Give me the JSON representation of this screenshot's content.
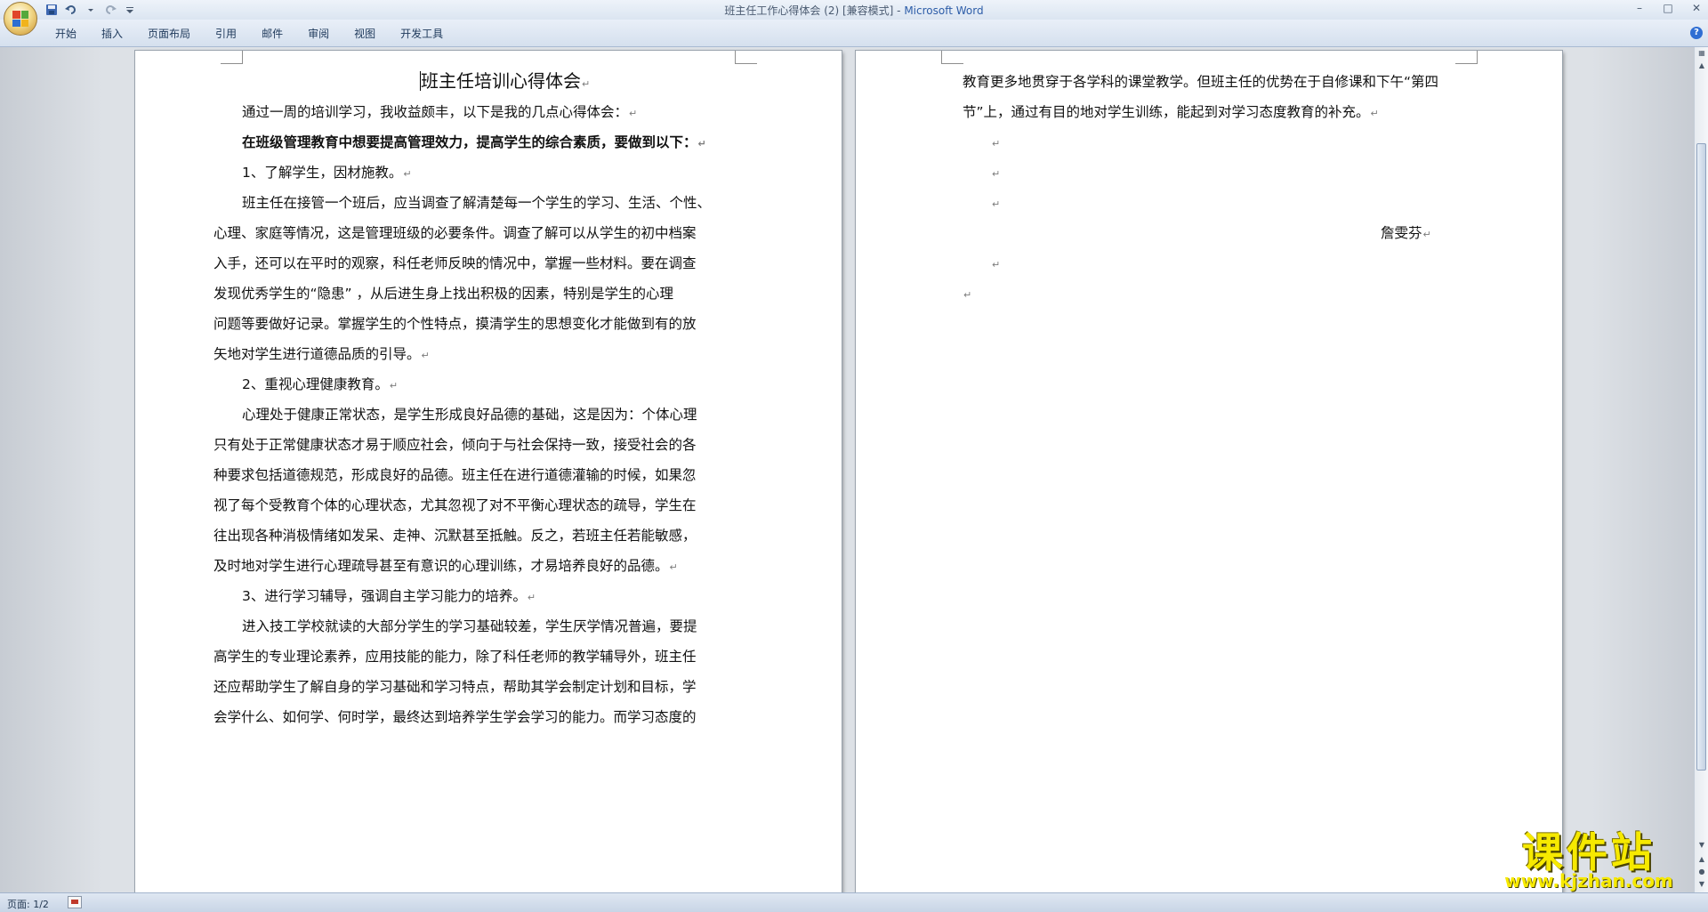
{
  "window": {
    "title_doc": "班主任工作心得体会 (2) [兼容模式] - ",
    "title_app": "Microsoft Word",
    "minimize": "–",
    "maximize": "□",
    "close": "✕"
  },
  "quick_access": {
    "save_icon": "save-icon",
    "undo_icon": "undo-icon",
    "redo_icon": "redo-icon",
    "customize_icon": "dropdown-icon"
  },
  "ribbon": {
    "tabs": [
      "开始",
      "插入",
      "页面布局",
      "引用",
      "邮件",
      "审阅",
      "视图",
      "开发工具"
    ],
    "help": "?"
  },
  "document": {
    "paragraph_mark": "↵",
    "page1": {
      "title": "班主任培训心得体会",
      "lines": [
        "通过一周的培训学习，我收益颇丰，以下是我的几点心得体会：",
        "在班级管理教育中想要提高管理效力，提高学生的综合素质，要做到以下：",
        "1、了解学生，因材施教。",
        "班主任在接管一个班后，应当调查了解清楚每一个学生的学习、生活、个性、",
        "心理、家庭等情况，这是管理班级的必要条件。调查了解可以从学生的初中档案",
        "入手，还可以在平时的观察，科任老师反映的情况中，掌握一些材料。要在调查",
        "发现优秀学生的“隐患” ，从后进生身上找出积极的因素，特别是学生的心理",
        "问题等要做好记录。掌握学生的个性特点，摸清学生的思想变化才能做到有的放",
        "矢地对学生进行道德品质的引导。",
        "2、重视心理健康教育。",
        "心理处于健康正常状态，是学生形成良好品德的基础，这是因为：个体心理",
        "只有处于正常健康状态才易于顺应社会，倾向于与社会保持一致，接受社会的各",
        "种要求包括道德规范，形成良好的品德。班主任在进行道德灌输的时候，如果忽",
        "视了每个受教育个体的心理状态，尤其忽视了对不平衡心理状态的疏导，学生在",
        "往出现各种消极情绪如发呆、走神、沉默甚至抵触。反之，若班主任若能敏感，",
        "及时地对学生进行心理疏导甚至有意识的心理训练，才易培养良好的品德。",
        "3、进行学习辅导，强调自主学习能力的培养。",
        "进入技工学校就读的大部分学生的学习基础较差，学生厌学情况普遍，要提",
        "高学生的专业理论素养，应用技能的能力，除了科任老师的教学辅导外，班主任",
        "还应帮助学生了解自身的学习基础和学习特点，帮助其学会制定计划和目标，学",
        "会学什么、如何学、何时学，最终达到培养学生学会学习的能力。而学习态度的"
      ]
    },
    "page2": {
      "lines": [
        "教育更多地贯穿于各学科的课堂教学。但班主任的优势在于自修课和下午“第四",
        "节”上，通过有目的地对学生训练，能起到对学习态度教育的补充。"
      ],
      "signature": "詹雯芬"
    }
  },
  "statusbar": {
    "page_info": "页面: 1/2"
  },
  "watermark": {
    "title": "课件站",
    "url": "www.kjzhan.com"
  },
  "colors": {
    "title_blue": "#2d5da8",
    "watermark_yellow": "#f6e900"
  }
}
